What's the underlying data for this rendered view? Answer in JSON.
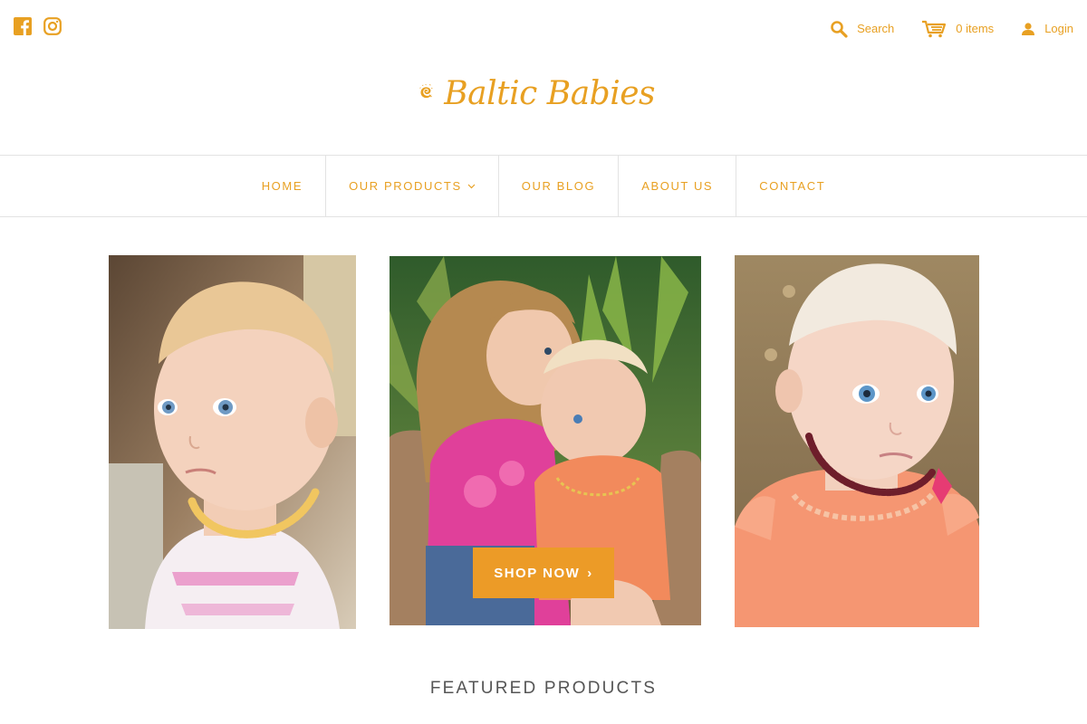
{
  "colors": {
    "accent": "#e8a022",
    "button": "#ec9b27",
    "heading": "#555555",
    "divider": "#e3e3e3"
  },
  "social": [
    {
      "icon": "facebook-icon"
    },
    {
      "icon": "instagram-icon"
    }
  ],
  "utility": {
    "search_label": "Search",
    "cart_label": "0 items",
    "login_label": "Login"
  },
  "logo": {
    "text": "Baltic Babies"
  },
  "nav": {
    "items": [
      {
        "label": "HOME"
      },
      {
        "label": "OUR PRODUCTS",
        "has_dropdown": true
      },
      {
        "label": "OUR BLOG"
      },
      {
        "label": "ABOUT US"
      },
      {
        "label": "CONTACT"
      }
    ]
  },
  "hero": {
    "shop_now_label": "SHOP NOW",
    "shop_now_arrow": "›"
  },
  "featured": {
    "title": "FEATURED PRODUCTS"
  }
}
